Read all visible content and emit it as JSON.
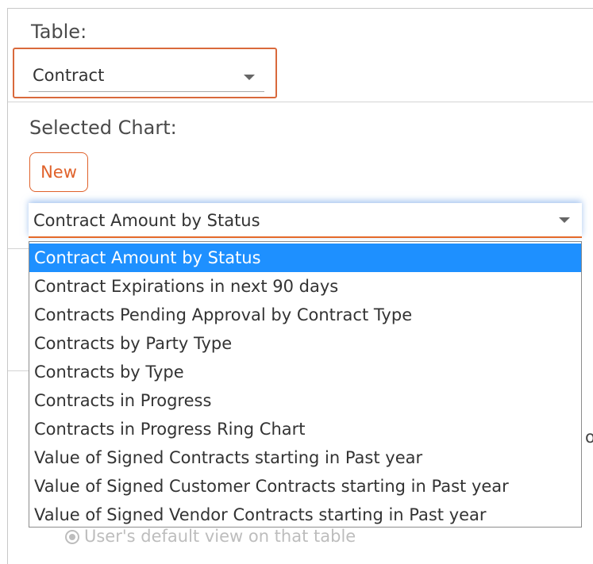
{
  "table": {
    "label": "Table:",
    "selected": "Contract"
  },
  "chart": {
    "label": "Selected Chart:",
    "new_button": "New",
    "selected": "Contract Amount by Status",
    "options": [
      "Contract Amount by Status",
      "Contract Expirations in next 90 days",
      "Contracts Pending Approval by Contract Type",
      "Contracts by Party Type",
      "Contracts by Type",
      "Contracts in Progress",
      "Contracts in Progress Ring Chart",
      "Value of Signed Contracts starting in Past year",
      "Value of Signed Customer Contracts starting in Past year",
      "Value of Signed Vendor Contracts starting in Past year"
    ]
  },
  "background": {
    "partial_text": "o",
    "radio_label": "User's default view on that table"
  },
  "colors": {
    "accent": "#e0622b",
    "highlight_box": "#d9693c",
    "selected_option_bg": "#1e90ff"
  }
}
